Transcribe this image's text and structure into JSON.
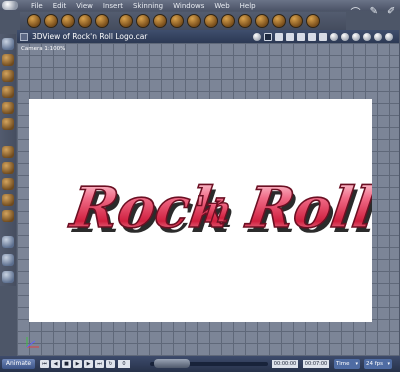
{
  "menubar": {
    "items": [
      "File",
      "Edit",
      "View",
      "Insert",
      "Skinning",
      "Windows",
      "Web",
      "Help"
    ]
  },
  "window": {
    "title": "3DView of Rock'n Roll Logo.car"
  },
  "viewport": {
    "camera_label": "Camera 1:100%",
    "logo": {
      "text_main": "Rock",
      "text_mid": "'n",
      "text_end": "Roll",
      "colors": {
        "face": "#e23a5c",
        "highlight": "#ffd6de",
        "shadow": "#2b2b2b",
        "outline": "#6b0f22"
      }
    }
  },
  "bottombar": {
    "animate_label": "Animate",
    "frame_value": "0",
    "time_now": "00:00:00",
    "time_end": "00:07:00",
    "time_mode": "Time",
    "fps": "24 fps"
  },
  "icons": {
    "toolbar": [
      "sphere-icon",
      "cube-icon",
      "cylinder-icon",
      "cone-icon",
      "torus-icon",
      "light-icon",
      "camera-icon",
      "group-icon",
      "morph-icon",
      "bone-icon",
      "skin-icon",
      "link-icon"
    ],
    "left_tools": [
      "select-arrow-icon",
      "move-icon",
      "rotate-icon",
      "scale-icon",
      "bend-icon",
      "wand-icon",
      "twist-icon",
      "hand-icon",
      "zoom-icon"
    ]
  },
  "colors": {
    "window_titlebar": "#2c3954",
    "accent_blue": "#4f6ca3"
  }
}
